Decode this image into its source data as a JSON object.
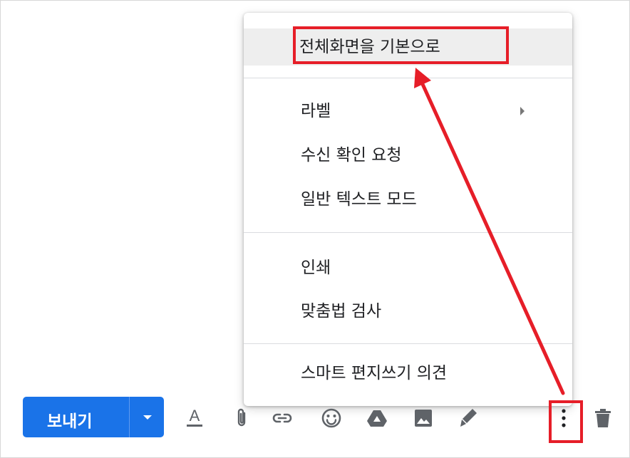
{
  "menu": {
    "items": [
      {
        "label": "전체화면을 기본으로"
      },
      {
        "label": "라벨"
      },
      {
        "label": "수신 확인 요청"
      },
      {
        "label": "일반 텍스트 모드"
      },
      {
        "label": "인쇄"
      },
      {
        "label": "맞춤법 검사"
      },
      {
        "label": "스마트 편지쓰기 의견"
      }
    ]
  },
  "compose": {
    "send_label": "보내기",
    "format_icon_glyph": "A"
  },
  "toolbar_icons": [
    "text-format-icon",
    "paperclip-icon",
    "link-icon",
    "emoji-icon",
    "drive-icon",
    "photo-icon",
    "signature-pen-icon",
    "more-options-icon",
    "trash-icon"
  ],
  "colors": {
    "send_button": "#1a73e8",
    "annotation": "#e61e28",
    "highlight": "#eeeeee"
  }
}
